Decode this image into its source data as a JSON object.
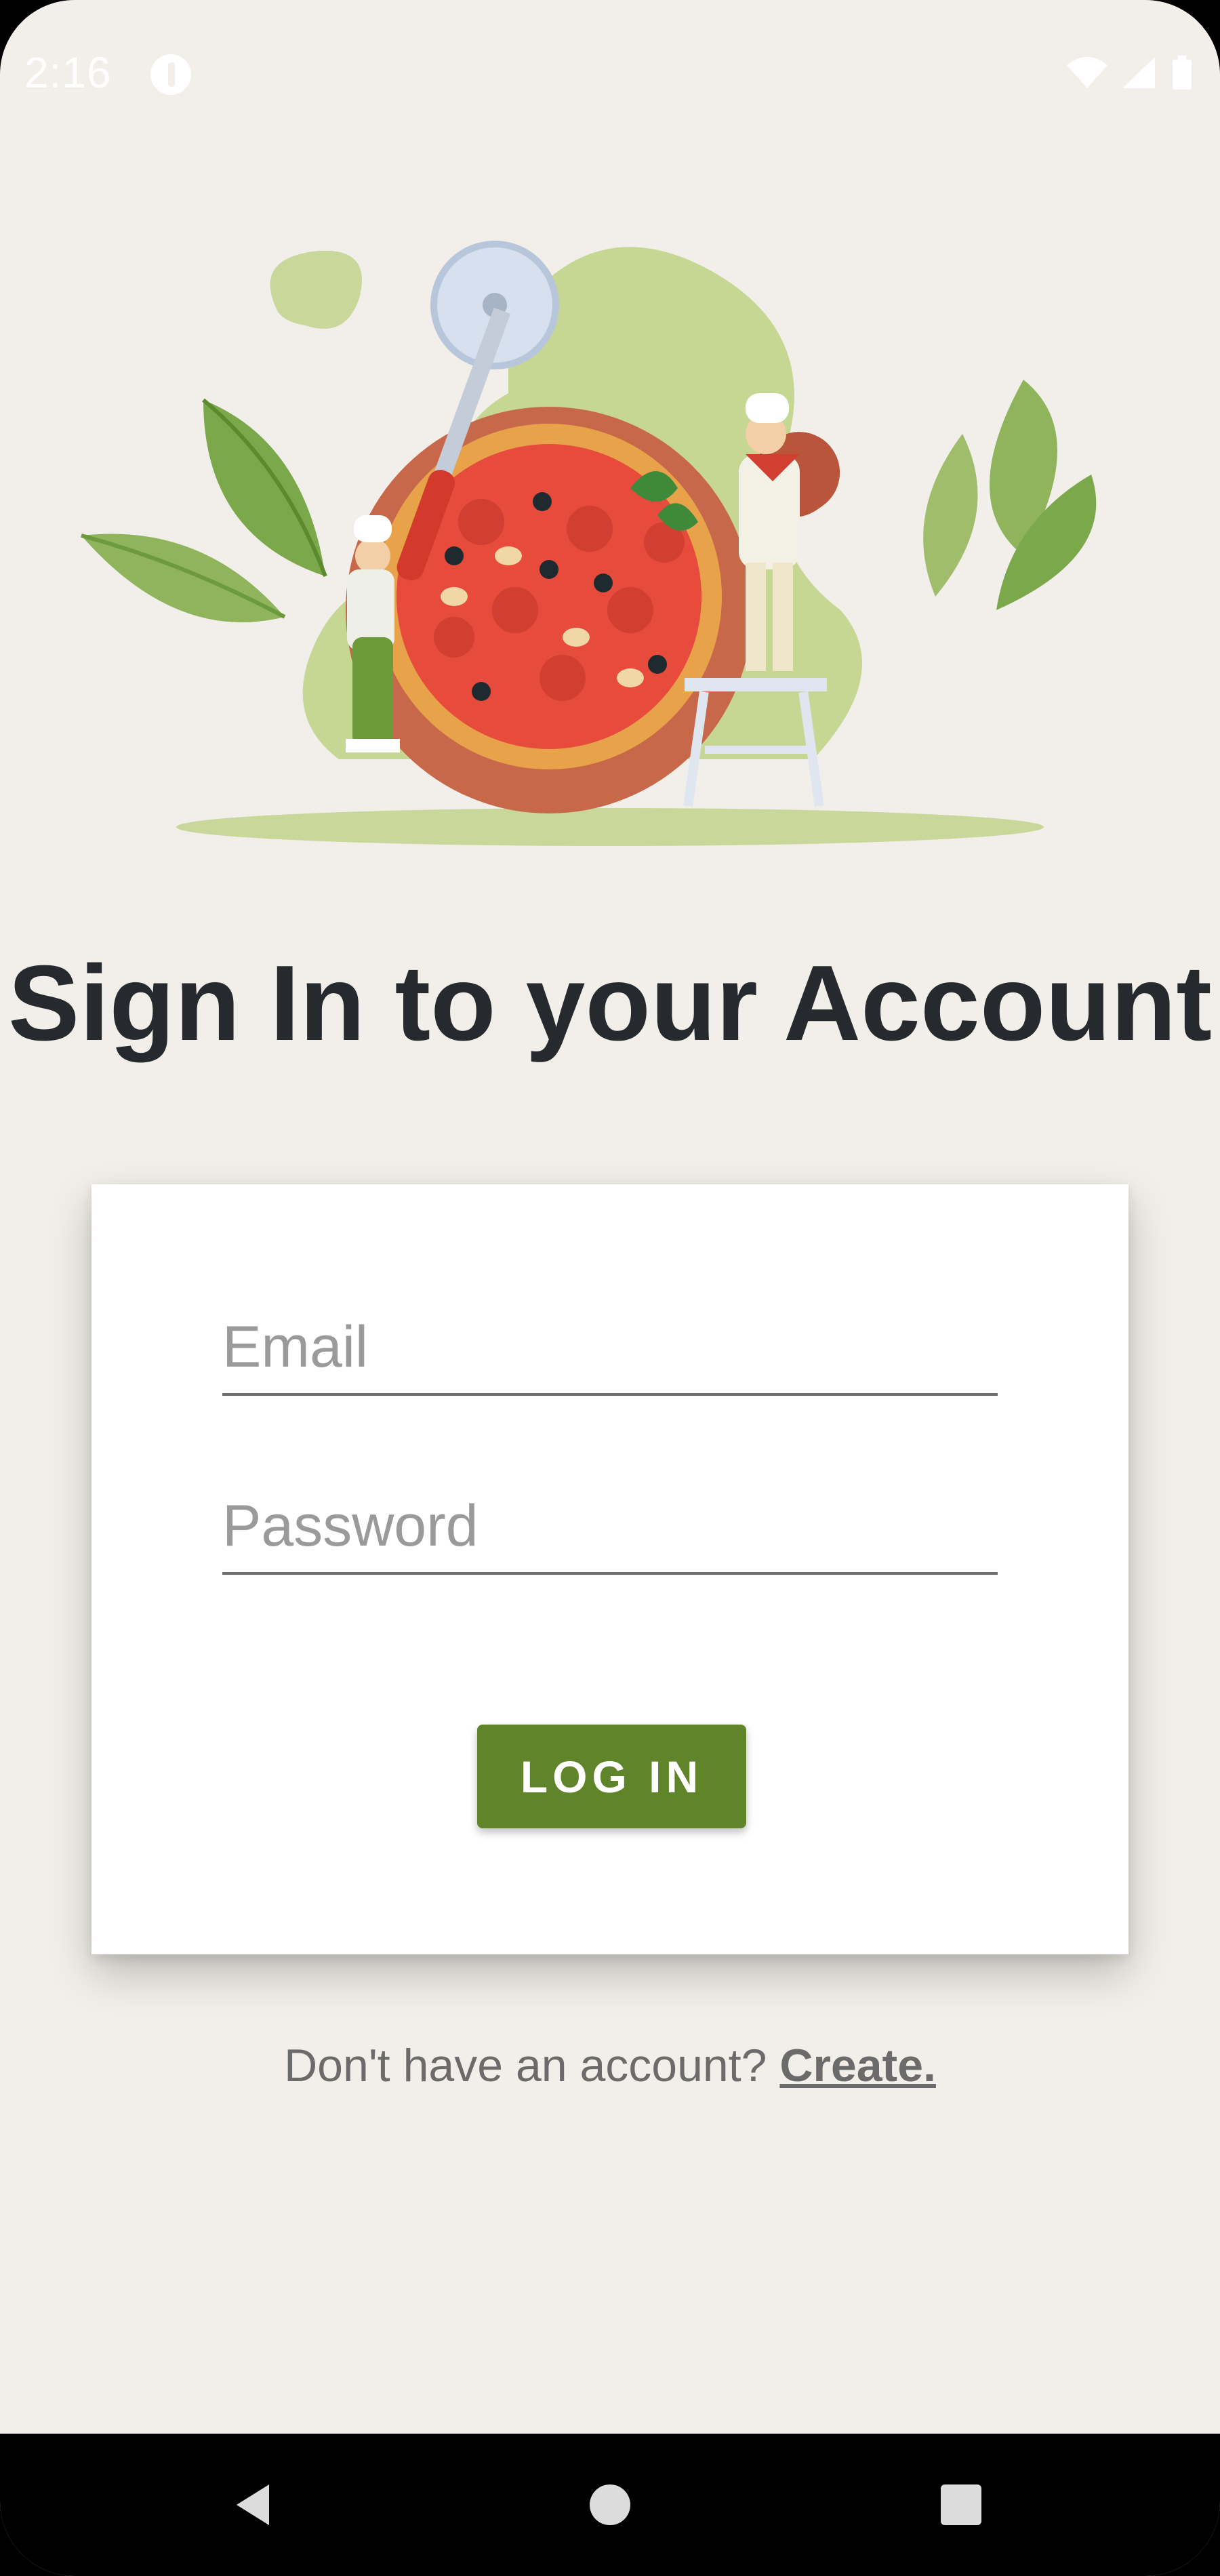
{
  "status_bar": {
    "time": "2:16",
    "icons": [
      "app-notification-icon",
      "wifi-icon",
      "cell-signal-icon",
      "battery-icon"
    ]
  },
  "illustration": {
    "description_icon": "chefs-pizza-illustration-icon"
  },
  "page": {
    "title": "Sign In to your Account"
  },
  "form": {
    "email_placeholder": "Email",
    "email_value": "",
    "password_placeholder": "Password",
    "password_value": "",
    "login_label": "LOG IN"
  },
  "signup": {
    "prompt": "Don't have an account? ",
    "link_label": "Create."
  },
  "nav_bar": {
    "icons": [
      "back-icon",
      "home-icon",
      "recents-icon"
    ]
  },
  "colors": {
    "background": "#f2efea",
    "title": "#262a2e",
    "accent_button": "#5f8429",
    "card": "#ffffff"
  }
}
